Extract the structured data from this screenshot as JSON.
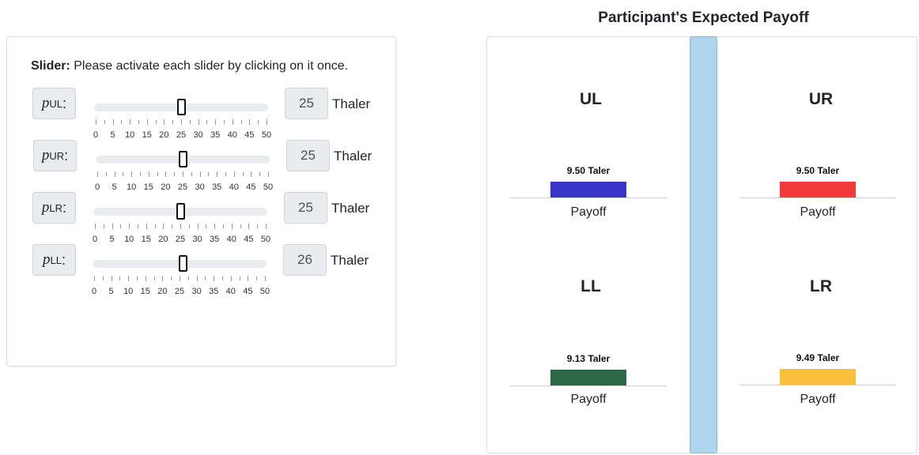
{
  "slider_panel": {
    "instruction_bold": "Slider:",
    "instruction_text": " Please activate each slider by clicking on it once.",
    "tick_labels": [
      "0",
      "5",
      "10",
      "15",
      "20",
      "25",
      "30",
      "35",
      "40",
      "45",
      "50"
    ],
    "max": 50,
    "sliders": [
      {
        "symbol": "p",
        "subscript": "UL",
        "suffix": ":",
        "value": "25",
        "unit": "Thaler"
      },
      {
        "symbol": "p",
        "subscript": "UR",
        "suffix": ":",
        "value": "25",
        "unit": "Thaler"
      },
      {
        "symbol": "p",
        "subscript": "LR",
        "suffix": ":",
        "value": "25",
        "unit": "Thaler"
      },
      {
        "symbol": "p",
        "subscript": "LL",
        "suffix": ":",
        "value": "26",
        "unit": "Thaler"
      }
    ]
  },
  "payoff_panel": {
    "title": "Participant's Expected Payoff",
    "quadrants": [
      {
        "name": "UL",
        "amount": "9.50 Taler",
        "label": "Payoff",
        "color": "#3a35c9"
      },
      {
        "name": "UR",
        "amount": "9.50 Taler",
        "label": "Payoff",
        "color": "#f23a3a"
      },
      {
        "name": "LL",
        "amount": "9.13 Taler",
        "label": "Payoff",
        "color": "#2c6a47"
      },
      {
        "name": "LR",
        "amount": "9.49 Taler",
        "label": "Payoff",
        "color": "#fbbf3a"
      }
    ]
  }
}
